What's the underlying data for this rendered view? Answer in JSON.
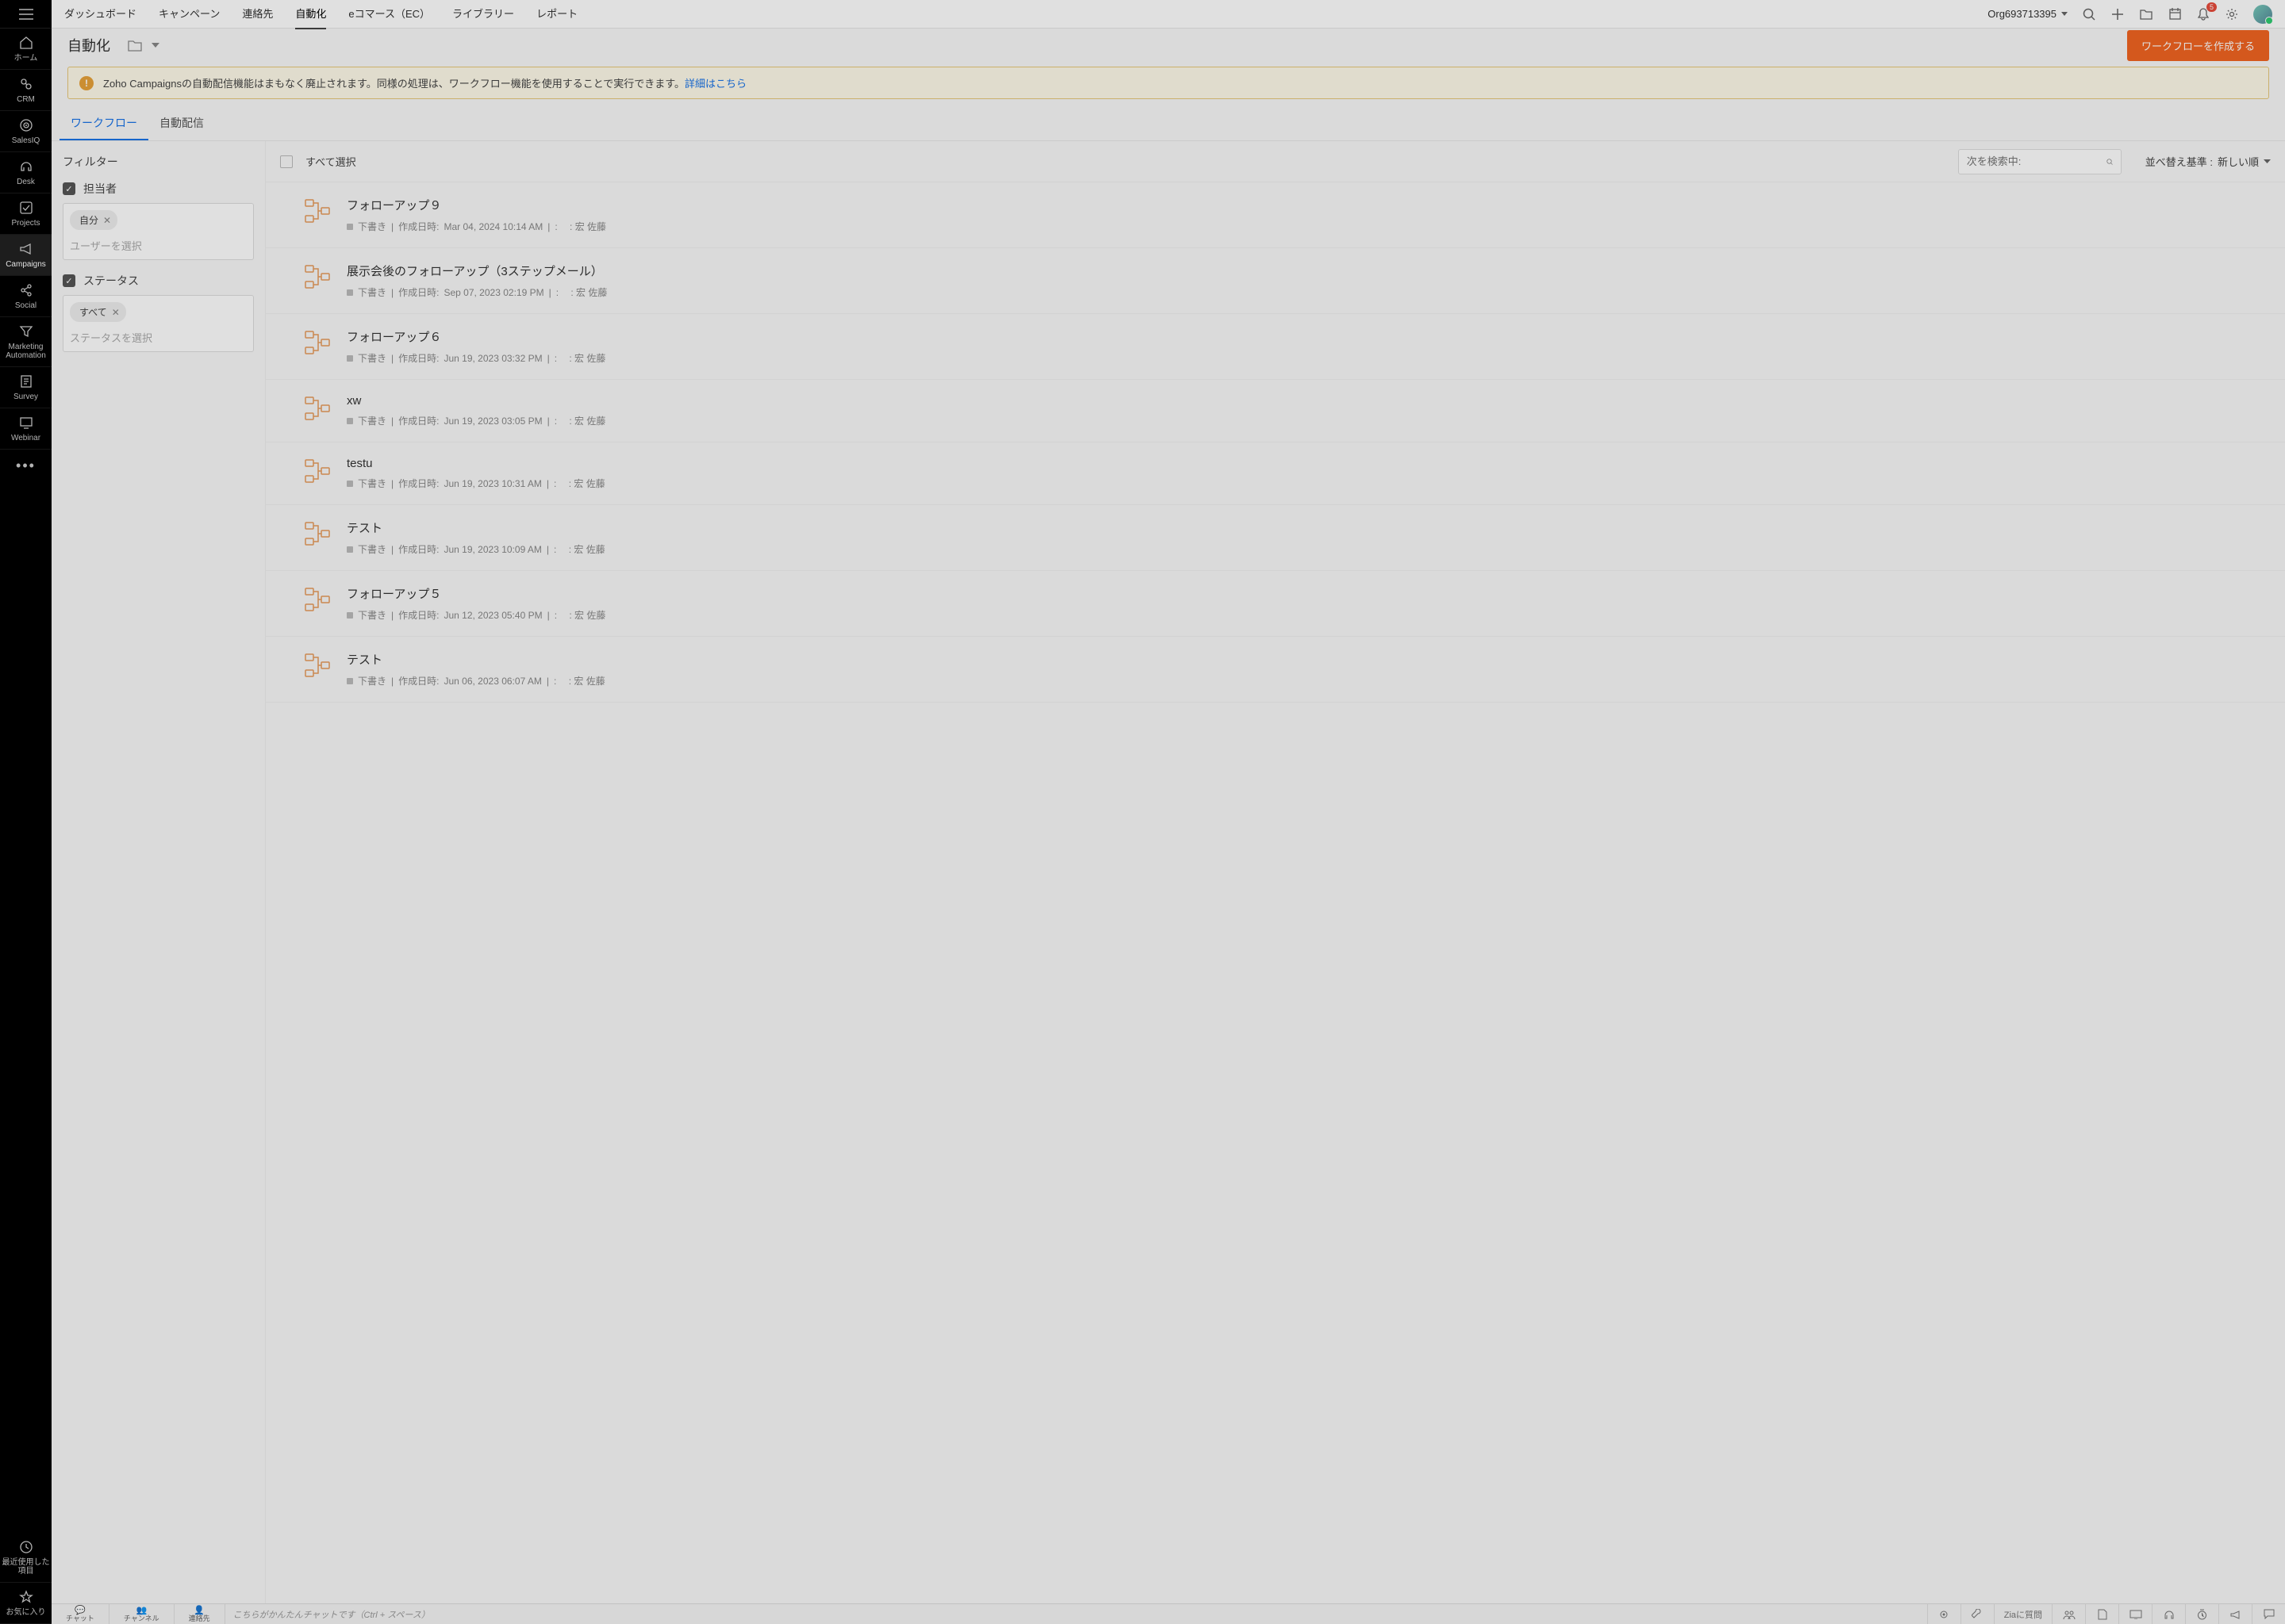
{
  "top_nav": {
    "tabs": [
      "ダッシュボード",
      "キャンペーン",
      "連絡先",
      "自動化",
      "eコマース（EC）",
      "ライブラリー",
      "レポート"
    ],
    "active_index": 3,
    "org": "Org693713395",
    "notif_badge": "5"
  },
  "left_rail": [
    {
      "label": "ホーム",
      "icon": "home-icon"
    },
    {
      "label": "CRM",
      "icon": "link-icon"
    },
    {
      "label": "SalesIQ",
      "icon": "radar-icon"
    },
    {
      "label": "Desk",
      "icon": "headset-icon"
    },
    {
      "label": "Projects",
      "icon": "check-icon"
    },
    {
      "label": "Campaigns",
      "icon": "megaphone-icon",
      "active": true
    },
    {
      "label": "Social",
      "icon": "share-icon"
    },
    {
      "label": "Marketing Automation",
      "icon": "funnel-icon"
    },
    {
      "label": "Survey",
      "icon": "survey-icon"
    },
    {
      "label": "Webinar",
      "icon": "webinar-icon"
    }
  ],
  "left_rail_bottom": [
    {
      "label": "最近使用した項目",
      "icon": "clock-icon"
    },
    {
      "label": "お気に入り",
      "icon": "star-icon"
    }
  ],
  "page": {
    "title": "自動化",
    "create_button": "ワークフローを作成する"
  },
  "notice": {
    "text": "Zoho Campaignsの自動配信機能はまもなく廃止されます。同様の処理は、ワークフロー機能を使用することで実行できます。",
    "link": "詳細はこちら"
  },
  "sub_tabs": {
    "items": [
      "ワークフロー",
      "自動配信"
    ],
    "active_index": 0
  },
  "filters": {
    "title": "フィルター",
    "groups": [
      {
        "label": "担当者",
        "chips": [
          "自分"
        ],
        "placeholder": "ユーザーを選択"
      },
      {
        "label": "ステータス",
        "chips": [
          "すべて"
        ],
        "placeholder": "ステータスを選択"
      }
    ]
  },
  "list_toolbar": {
    "select_all": "すべて選択",
    "search_placeholder": "次を検索中:",
    "sort_label": "並べ替え基準 :",
    "sort_value": "新しい順"
  },
  "meta_labels": {
    "status": "下書き",
    "created": "作成日時:",
    "by": ": 宏 佐藤"
  },
  "workflows": [
    {
      "title": "フォローアップ９",
      "date": "Mar 04, 2024 10:14 AM"
    },
    {
      "title": "展示会後のフォローアップ（3ステップメール）",
      "date": "Sep 07, 2023 02:19 PM"
    },
    {
      "title": "フォローアップ６",
      "date": "Jun 19, 2023 03:32 PM"
    },
    {
      "title": "xw",
      "date": "Jun 19, 2023 03:05 PM"
    },
    {
      "title": "testu",
      "date": "Jun 19, 2023 10:31 AM"
    },
    {
      "title": "テスト",
      "date": "Jun 19, 2023 10:09 AM"
    },
    {
      "title": "フォローアップ５",
      "date": "Jun 12, 2023 05:40 PM"
    },
    {
      "title": "テスト",
      "date": "Jun 06, 2023 06:07 AM"
    }
  ],
  "bottom_bar": {
    "items": [
      {
        "label": "チャット"
      },
      {
        "label": "チャンネル"
      },
      {
        "label": "連絡先"
      }
    ],
    "chat_placeholder": "こちらがかんたんチャットです（Ctrl + スペース）",
    "zia": "Ziaに質問"
  }
}
